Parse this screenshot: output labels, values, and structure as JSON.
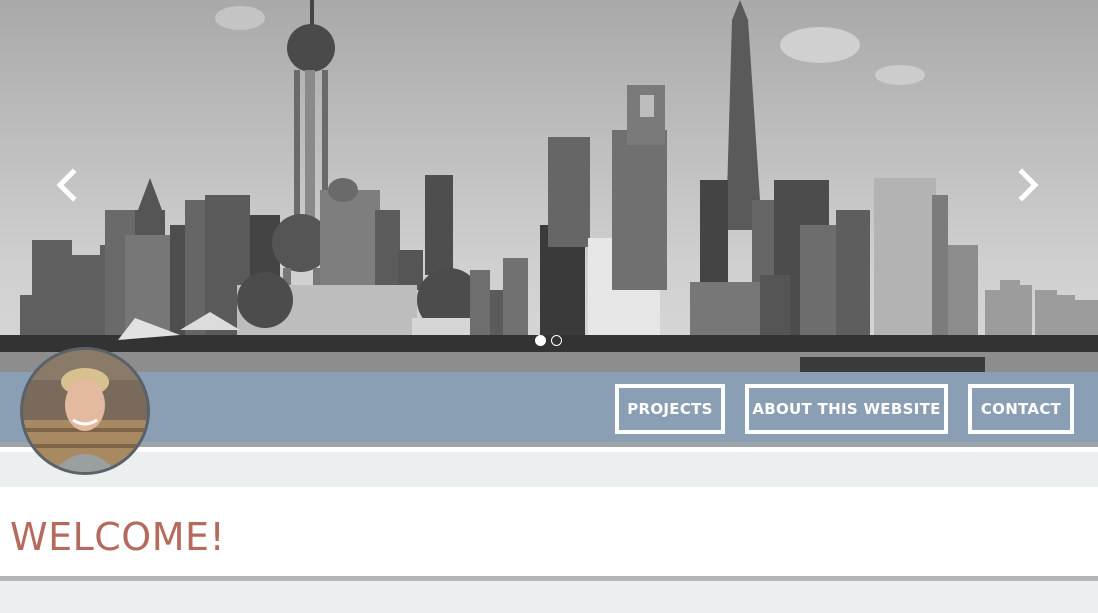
{
  "hero": {
    "prev_icon": "chevron-left-icon",
    "next_icon": "chevron-right-icon",
    "slide_count": 2,
    "active_slide": 1
  },
  "nav": {
    "items": [
      {
        "label": "PROJECTS"
      },
      {
        "label": "ABOUT THIS WEBSITE"
      },
      {
        "label": "CONTACT"
      }
    ]
  },
  "main": {
    "title": "WELCOME!"
  },
  "colors": {
    "navbar": "#8a9fb3",
    "title": "#b46a5c",
    "band": "#eceff0"
  }
}
